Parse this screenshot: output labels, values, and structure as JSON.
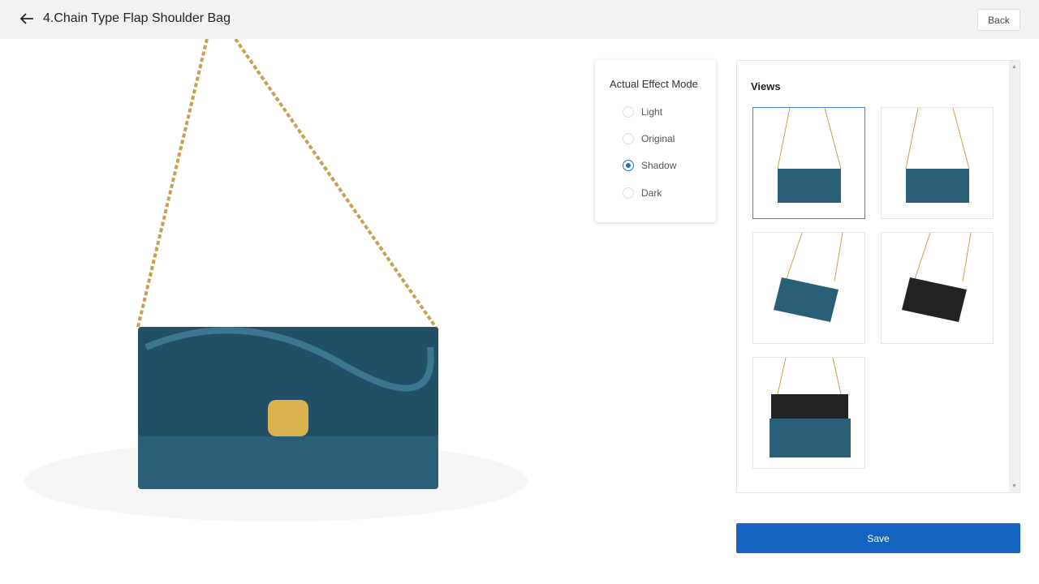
{
  "header": {
    "title": "4.Chain Type Flap Shoulder Bag",
    "back_label": "Back"
  },
  "effect_mode": {
    "title": "Actual Effect Mode",
    "options": [
      "Light",
      "Original",
      "Shadow",
      "Dark"
    ],
    "selected": "Shadow"
  },
  "views": {
    "title": "Views",
    "count": 5,
    "selected_index": 0
  },
  "save_label": "Save",
  "colors": {
    "accent": "#1565c0",
    "bag_teal": "#2b5f78",
    "chain_gold": "#c9a04e"
  }
}
